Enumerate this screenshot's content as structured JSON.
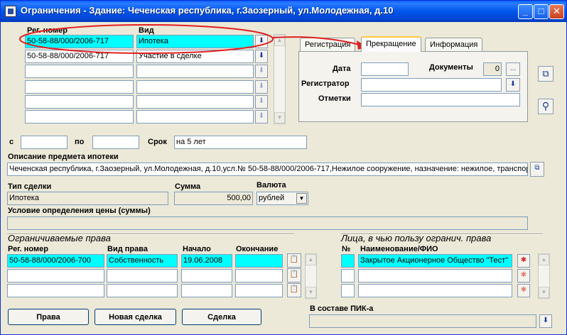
{
  "window": {
    "title": "Ограничения - Здание: Чеченская республика, г.Заозерный, ул.Молодежная, д.10",
    "minimize": "_",
    "maximize": "□",
    "close": "✕"
  },
  "top_grid": {
    "headers": {
      "reg": "Рег. номер",
      "vid": "Вид"
    },
    "rows": [
      {
        "reg": "50-58-88/000/2006-717",
        "vid": "Ипотека"
      },
      {
        "reg": "50-58-88/000/2006-717",
        "vid": "Участие в сделке"
      },
      {
        "reg": "",
        "vid": ""
      },
      {
        "reg": "",
        "vid": ""
      },
      {
        "reg": "",
        "vid": ""
      },
      {
        "reg": "",
        "vid": ""
      }
    ]
  },
  "tabs": [
    {
      "label": "Регистрация"
    },
    {
      "label": "Прекращение"
    },
    {
      "label": "Информация"
    }
  ],
  "tab_panel": {
    "date_label": "Дата",
    "documents_label": "Документы",
    "documents_count": "0",
    "more": "...",
    "registrar_label": "Регистратор",
    "notes_label": "Отметки"
  },
  "period": {
    "from_label": "с",
    "to_label": "по",
    "term_label": "Срок",
    "term_value": "на 5 лет"
  },
  "subject": {
    "label": "Описание предмета ипотеки",
    "value": "Чеченская республика, г.Заозерный, ул.Молодежная, д.10,усл.№ 50-58-88/000/2006-717,Нежилое сооружение, назначение: нежилое, транспорт"
  },
  "deal": {
    "type_label": "Тип сделки",
    "type_value": "Ипотека",
    "sum_label": "Сумма",
    "sum_value": "500,00",
    "currency_label": "Валюта",
    "currency_value": "рублей"
  },
  "price_condition": {
    "label": "Условие определения цены (суммы)",
    "value": ""
  },
  "rights": {
    "heading": "Ограничиваемые права",
    "headers": {
      "reg": "Рег. номер",
      "vid": "Вид права",
      "start": "Начало",
      "end": "Окончание"
    },
    "rows": [
      {
        "reg": "50-58-88/000/2006-700",
        "vid": "Собственность",
        "start": "19.06.2008",
        "end": ""
      },
      {
        "reg": "",
        "vid": "",
        "start": "",
        "end": ""
      },
      {
        "reg": "",
        "vid": "",
        "start": "",
        "end": ""
      }
    ]
  },
  "persons": {
    "heading": "Лица, в чью пользу огранич. права",
    "headers": {
      "num": "№",
      "name": "Наименование/ФИО"
    },
    "rows": [
      {
        "num": "",
        "name": "Закрытое Акционерное Общество \"Тест\""
      },
      {
        "num": "",
        "name": ""
      },
      {
        "num": "",
        "name": ""
      }
    ]
  },
  "buttons": {
    "rights": "Права",
    "new_deal": "Новая сделка",
    "deal": "Сделка"
  },
  "pik": {
    "label": "В составе ПИК-а",
    "value": ""
  },
  "icons": {
    "down": "⬇",
    "dropdown": "▼",
    "up": "▲",
    "copy": "⧉",
    "search": "⚲",
    "clipboard": "📋",
    "pin": "✱"
  },
  "colors": {
    "highlight": "#00ffff",
    "annotation": "#e02020"
  }
}
